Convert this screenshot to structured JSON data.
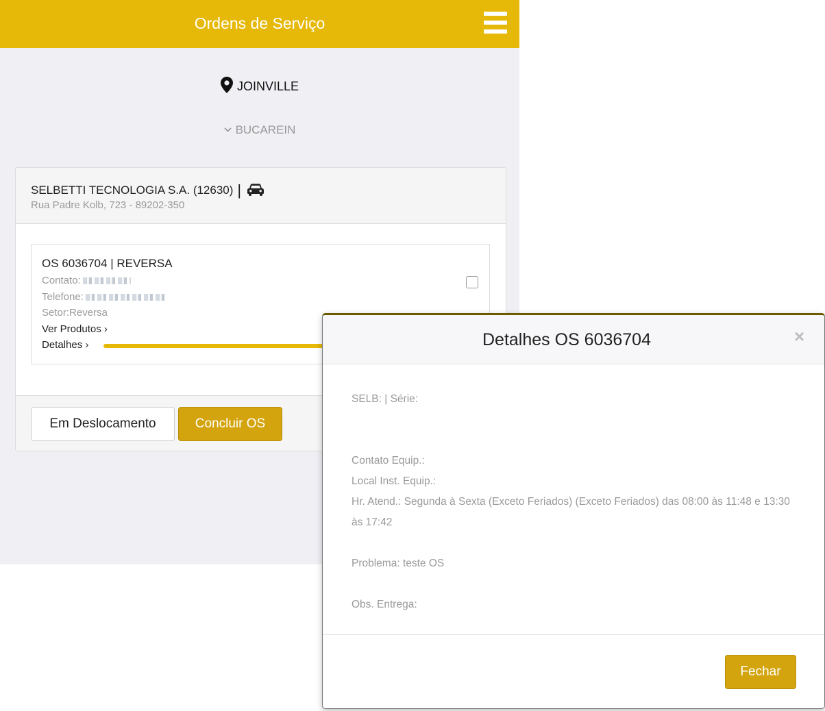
{
  "header": {
    "title": "Ordens de Serviço",
    "menu_icon": "hamburger-menu-icon"
  },
  "location": {
    "city": "JOINVILLE",
    "region": "BUCAREIN"
  },
  "card": {
    "company": "SELBETTI TECNOLOGIA S.A. (12630)",
    "separator": "|",
    "vehicle_icon": "car-icon",
    "address": "Rua Padre Kolb, 723 - 89202-350",
    "order": {
      "title": "OS 6036704 | REVERSA",
      "contato_label": "Contato:",
      "telefone_label": "Telefone:",
      "setor": "Setor:Reversa",
      "ver_produtos": "Ver Produtos",
      "detalhes": "Detalhes",
      "chevron": "›"
    },
    "buttons": {
      "em_deslocamento": "Em Deslocamento",
      "concluir": "Concluir OS"
    }
  },
  "modal": {
    "title": "Detalhes OS 6036704",
    "close": "×",
    "selb": "SELB: | Série:",
    "contato_equip": "Contato Equip.:",
    "local_inst": "Local Inst. Equip.:",
    "hr_atend": "Hr. Atend.: Segunda à Sexta (Exceto Feriados) (Exceto Feriados) das 08:00 às 11:48 e 13:30 às 17:42",
    "problema": "Problema: teste OS",
    "obs_entrega": "Obs. Entrega:",
    "fechar": "Fechar"
  },
  "colors": {
    "brand": "#e6b807",
    "button_gold": "#d3a40d",
    "background": "#efeff4"
  }
}
